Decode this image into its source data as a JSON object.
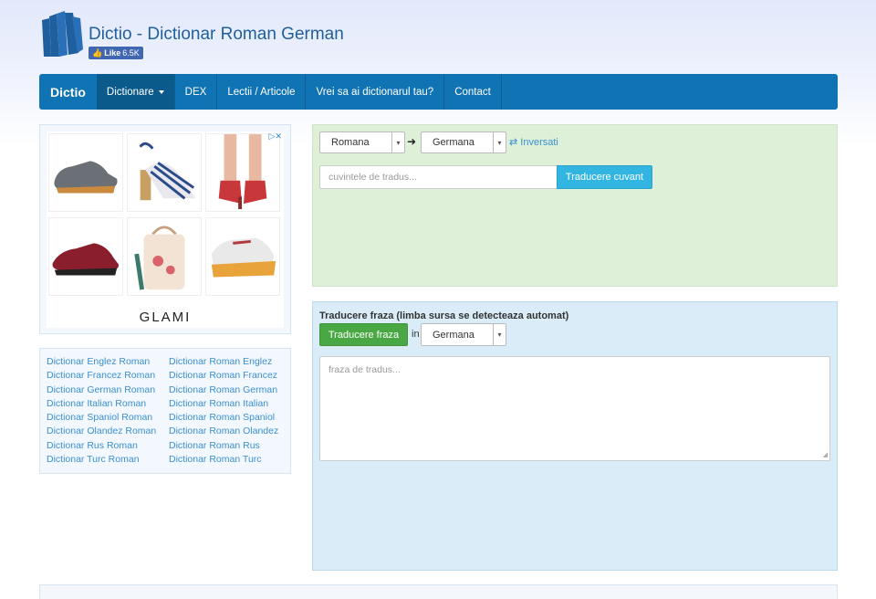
{
  "site": {
    "title": "Dictio - Dictionar Roman German",
    "like_label": "Like",
    "like_count": "6.5K"
  },
  "nav": {
    "brand": "Dictio",
    "items": [
      {
        "label": "Dictionare",
        "dropdown": true,
        "active": true
      },
      {
        "label": "DEX"
      },
      {
        "label": "Lectii / Articole"
      },
      {
        "label": "Vrei sa ai dictionarul tau?"
      },
      {
        "label": "Contact"
      }
    ]
  },
  "ad": {
    "brand": "GLAMI",
    "choices_icon": "adchoices-icon",
    "products": [
      "grey-sneaker",
      "striped-sandal",
      "red-heel",
      "red-sneaker",
      "floral-bag",
      "chunky-sneaker"
    ]
  },
  "links": [
    [
      "Dictionar Englez Roman",
      "Dictionar Roman Englez"
    ],
    [
      "Dictionar Francez Roman",
      "Dictionar Roman Francez"
    ],
    [
      "Dictionar German Roman",
      "Dictionar Roman German"
    ],
    [
      "Dictionar Italian Roman",
      "Dictionar Roman Italian"
    ],
    [
      "Dictionar Spaniol Roman",
      "Dictionar Roman Spaniol"
    ],
    [
      "Dictionar Olandez Roman",
      "Dictionar Roman Olandez"
    ],
    [
      "Dictionar Rus Roman",
      "Dictionar Roman Rus"
    ],
    [
      "Dictionar Turc Roman",
      "Dictionar Roman Turc"
    ]
  ],
  "word_translate": {
    "source_lang": "Romana",
    "target_lang": "Germana",
    "inverse_label": "Inversati",
    "input_placeholder": "cuvintele de tradus...",
    "button_label": "Traducere cuvant"
  },
  "phrase_translate": {
    "title": "Traducere fraza (limba sursa se detecteaza automat)",
    "button_label": "Traducere fraza",
    "in_label": "in",
    "target_lang": "Germana",
    "textarea_placeholder": "fraza de tradus..."
  },
  "colors": {
    "nav_bg": "#0f73b4",
    "word_panel_bg": "#dff0d8",
    "phrase_panel_bg": "#d9ecf7",
    "word_button": "#32b5e0",
    "phrase_button": "#4aa844",
    "link": "#3a8fd0"
  }
}
